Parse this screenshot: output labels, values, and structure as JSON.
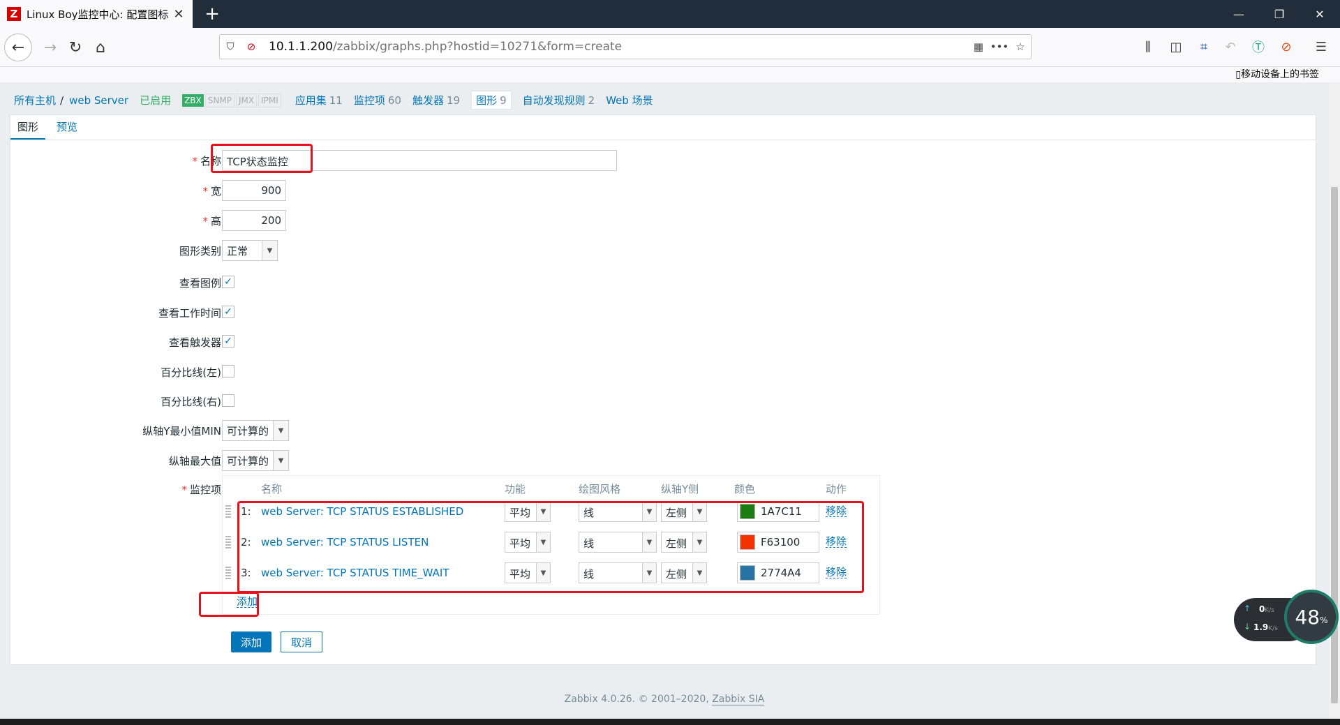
{
  "browser": {
    "tab_title": "Linux Boy监控中心: 配置图标",
    "tab_favicon": "Z",
    "url_host": "10.1.1.200",
    "url_path": "/zabbix/graphs.php?hostid=10271&form=create",
    "mobile_bookmarks": "移动设备上的书签"
  },
  "hostnav": {
    "all_hosts": "所有主机",
    "separator": "/",
    "host": "web Server",
    "enabled": "已启用",
    "badges": [
      "ZBX",
      "SNMP",
      "JMX",
      "IPMI"
    ],
    "links": [
      {
        "label": "应用集",
        "count": "11"
      },
      {
        "label": "监控项",
        "count": "60"
      },
      {
        "label": "触发器",
        "count": "19"
      },
      {
        "label": "图形",
        "count": "9"
      },
      {
        "label": "自动发现规则",
        "count": "2"
      },
      {
        "label": "Web 场景",
        "count": ""
      }
    ]
  },
  "tabs": {
    "graph": "图形",
    "preview": "预览"
  },
  "form": {
    "name_label": "名称",
    "name_value": "TCP状态监控",
    "width_label": "宽",
    "width_value": "900",
    "height_label": "高",
    "height_value": "200",
    "type_label": "图形类别",
    "type_value": "正常",
    "show_legend_label": "查看图例",
    "show_work_label": "查看工作时间",
    "show_triggers_label": "查看触发器",
    "percent_left_label": "百分比线(左)",
    "percent_right_label": "百分比线(右)",
    "ymin_label": "纵轴Y最小值MIN",
    "ymin_value": "可计算的",
    "ymax_label": "纵轴最大值",
    "ymax_value": "可计算的",
    "items_label": "监控项",
    "checkmark": "✓"
  },
  "items_table": {
    "headers": [
      "名称",
      "功能",
      "绘图风格",
      "纵轴Y侧",
      "颜色",
      "动作"
    ],
    "rows": [
      {
        "num": "1:",
        "name": "web Server: TCP STATUS ESTABLISHED",
        "func": "平均",
        "style": "线",
        "side": "左侧",
        "color": "1A7C11",
        "action": "移除"
      },
      {
        "num": "2:",
        "name": "web Server: TCP STATUS LISTEN",
        "func": "平均",
        "style": "线",
        "side": "左侧",
        "color": "F63100",
        "action": "移除"
      },
      {
        "num": "3:",
        "name": "web Server: TCP STATUS TIME_WAIT",
        "func": "平均",
        "style": "线",
        "side": "左侧",
        "color": "2774A4",
        "action": "移除"
      }
    ],
    "add_link": "添加"
  },
  "buttons": {
    "add": "添加",
    "cancel": "取消"
  },
  "footer": {
    "text": "Zabbix 4.0.26. © 2001–2020, ",
    "company": "Zabbix SIA"
  },
  "speed_widget": {
    "up": "0",
    "up_unit": "K/s",
    "down": "1.9",
    "down_unit": "K/s",
    "percent": "48",
    "percent_sign": "%"
  }
}
